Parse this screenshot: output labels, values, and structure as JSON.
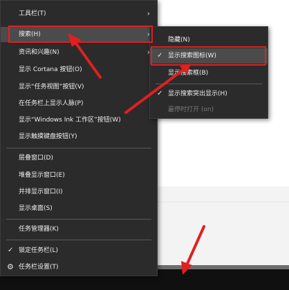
{
  "context_menu": {
    "items": [
      {
        "label": "工具栏(T)"
      },
      {
        "label": "搜索(H)"
      },
      {
        "label": "资讯和兴趣(N)"
      },
      {
        "label": "显示 Cortana 按钮(O)"
      },
      {
        "label": "显示“任务视图”按钮(V)"
      },
      {
        "label": "在任务栏上显示人脉(P)"
      },
      {
        "label": "显示“Windows Ink 工作区”按钮(W)"
      },
      {
        "label": "显示触摸键盘按钮(Y)"
      },
      {
        "label": "层叠窗口(D)"
      },
      {
        "label": "堆叠显示窗口(E)"
      },
      {
        "label": "并排显示窗口(I)"
      },
      {
        "label": "显示桌面(S)"
      },
      {
        "label": "任务管理器(K)"
      },
      {
        "label": "锁定任务栏(L)"
      },
      {
        "label": "任务栏设置(T)"
      }
    ]
  },
  "search_submenu": {
    "items": [
      {
        "label": "隐藏(N)"
      },
      {
        "label": "显示搜索图标(W)"
      },
      {
        "label": "显示搜索框(B)"
      },
      {
        "label": "显示搜索突出显示(H)"
      },
      {
        "label": "最停时打开 (on)"
      }
    ]
  },
  "colors": {
    "menu_bg": "#2b2b2b",
    "highlight": "#4b4b4b",
    "annotation": "#e02020"
  },
  "icons": [
    "chevron-right-icon",
    "check-icon",
    "gear-icon"
  ]
}
